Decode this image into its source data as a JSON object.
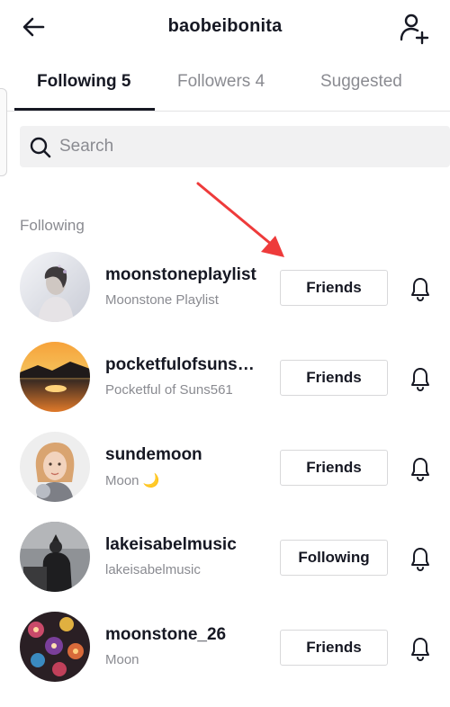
{
  "header": {
    "title": "baobeibonita"
  },
  "tabs": [
    {
      "label": "Following 5",
      "active": true
    },
    {
      "label": "Followers 4",
      "active": false
    },
    {
      "label": "Suggested",
      "active": false
    }
  ],
  "search": {
    "placeholder": "Search"
  },
  "section": {
    "label": "Following"
  },
  "users": [
    {
      "username": "moonstoneplaylist",
      "nickname": "Moonstone Playlist",
      "button": "Friends"
    },
    {
      "username": "pocketfulofsuns…",
      "nickname": "Pocketful of Suns561",
      "button": "Friends"
    },
    {
      "username": "sundemoon",
      "nickname": "Moon",
      "nickname_emoji": "🌙",
      "button": "Friends"
    },
    {
      "username": "lakeisabelmusic",
      "nickname": "lakeisabelmusic",
      "button": "Following"
    },
    {
      "username": "moonstone_26",
      "nickname": "Moon",
      "button": "Friends"
    }
  ],
  "colors": {
    "text": "#161823",
    "muted": "#8a8b91",
    "arrow": "#ee3b3b",
    "divider": "#e3e3e4"
  },
  "icons": [
    "back-arrow-icon",
    "add-user-icon",
    "search-icon",
    "bell-icon",
    "annotation-arrow"
  ]
}
